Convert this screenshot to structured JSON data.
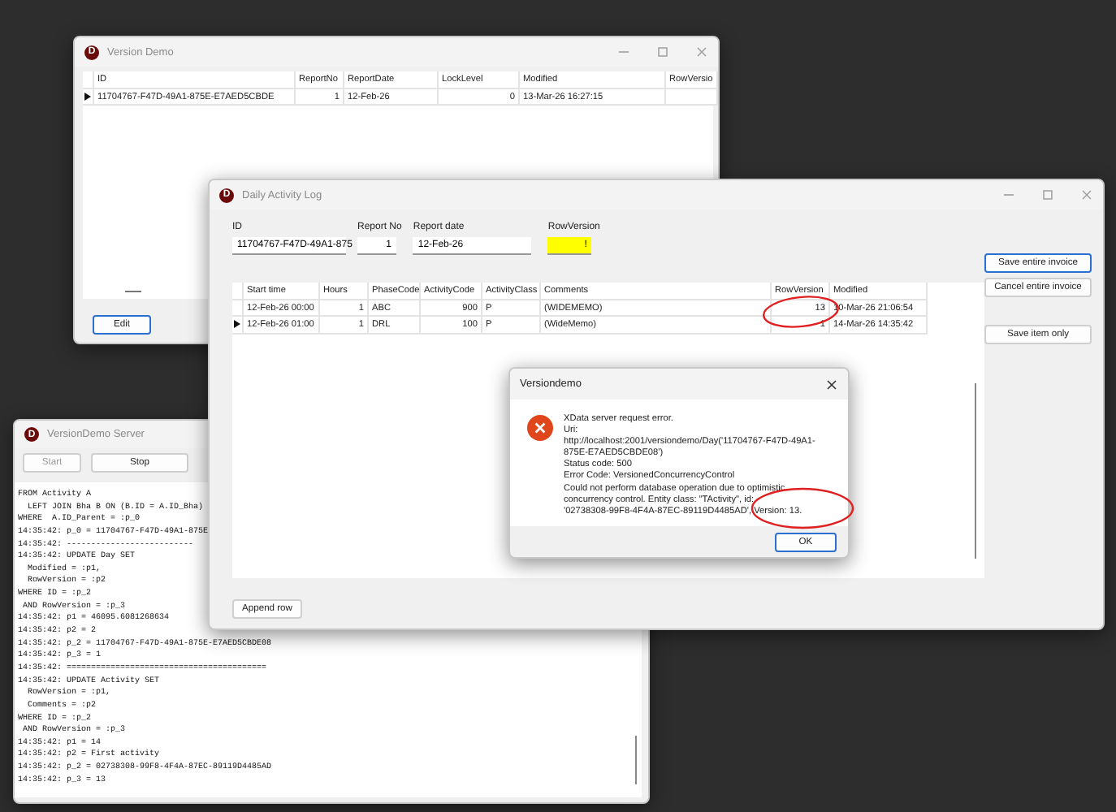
{
  "version_demo": {
    "icon": "D",
    "title": "Version Demo",
    "columns": [
      "ID",
      "ReportNo",
      "ReportDate",
      "LockLevel",
      "Modified",
      "RowVersio"
    ],
    "rows": [
      {
        "selected": true,
        "cells": [
          "11704767-F47D-49A1-875E-E7AED5CBDE",
          "1",
          "12-Feb-26",
          "0",
          "13-Mar-26 16:27:15",
          ""
        ]
      }
    ],
    "buttons": [
      "Edit"
    ]
  },
  "server": {
    "icon": "D",
    "title": "VersionDemo Server",
    "buttons": [
      {
        "label": "Start",
        "disabled": true
      },
      {
        "label": "Stop",
        "disabled": false
      }
    ],
    "log": [
      "FROM Activity A",
      "  LEFT JOIN Bha B ON (B.ID = A.ID_Bha)",
      "WHERE  A.ID_Parent = :p_0",
      "14:35:42: p_0 = 11704767-F47D-49A1-875E",
      "14:35:42: --------------------------",
      "14:35:42: UPDATE Day SET",
      "  Modified = :p1,",
      "  RowVersion = :p2",
      "WHERE ID = :p_2",
      " AND RowVersion = :p_3",
      "14:35:42: p1 = 46095.6081268634",
      "14:35:42: p2 = 2",
      "14:35:42: p_2 = 11704767-F47D-49A1-875E-E7AED5CBDE08",
      "14:35:42: p_3 = 1",
      "14:35:42: =========================================",
      "14:35:42: UPDATE Activity SET",
      "  RowVersion = :p1,",
      "  Comments = :p2",
      "WHERE ID = :p_2",
      " AND RowVersion = :p_3",
      "14:35:42: p1 = 14",
      "14:35:42: p2 = First activity",
      "14:35:42: p_2 = 02738308-99F8-4F4A-87EC-89119D4485AD",
      "14:35:42: p_3 = 13"
    ]
  },
  "activity_log": {
    "icon": "D",
    "title": "Daily Activity Log",
    "fields": [
      {
        "label": "ID",
        "value": "11704767-F47D-49A1-875",
        "kind": "text",
        "highlighted": false
      },
      {
        "label": "Report No",
        "value": "1",
        "kind": "number",
        "highlighted": false
      },
      {
        "label": "Report date",
        "value": "12-Feb-26",
        "kind": "text",
        "highlighted": false
      },
      {
        "label": "RowVersion",
        "value": "!",
        "kind": "number",
        "highlighted": true
      }
    ],
    "side_buttons": [
      {
        "label": "Save entire invoice",
        "default": true
      },
      {
        "label": "Cancel entire invoice",
        "default": false
      },
      {
        "label": "Save item only",
        "default": false
      }
    ],
    "grid": {
      "columns": [
        "Start time",
        "Hours",
        "PhaseCode",
        "ActivityCode",
        "ActivityClass",
        "Comments",
        "RowVersion",
        "Modified"
      ],
      "rows": [
        {
          "selected": false,
          "cells": [
            "12-Feb-26 00:00",
            "1",
            "ABC",
            "900",
            "P",
            "(WIDEMEMO)",
            "13",
            "10-Mar-26 21:06:54"
          ]
        },
        {
          "selected": true,
          "cells": [
            "12-Feb-26 01:00",
            "1",
            "DRL",
            "100",
            "P",
            "(WideMemo)",
            "1",
            "14-Mar-26 14:35:42"
          ]
        }
      ]
    },
    "append_button": "Append row"
  },
  "dialog": {
    "title": "Versiondemo",
    "message": "XData server request error.\nUri:\nhttp://localhost:2001/versiondemo/Day('11704767-F47D-49A1-\n875E-E7AED5CBDE08')\nStatus code: 500\nError Code: VersionedConcurrencyControl\nCould not perform database operation due to optimistic\nconcurrency control. Entity class: \"TActivity\", id:\n'02738308-99F8-4F4A-87EC-89119D4485AD', Version: 13.",
    "button": "OK"
  }
}
